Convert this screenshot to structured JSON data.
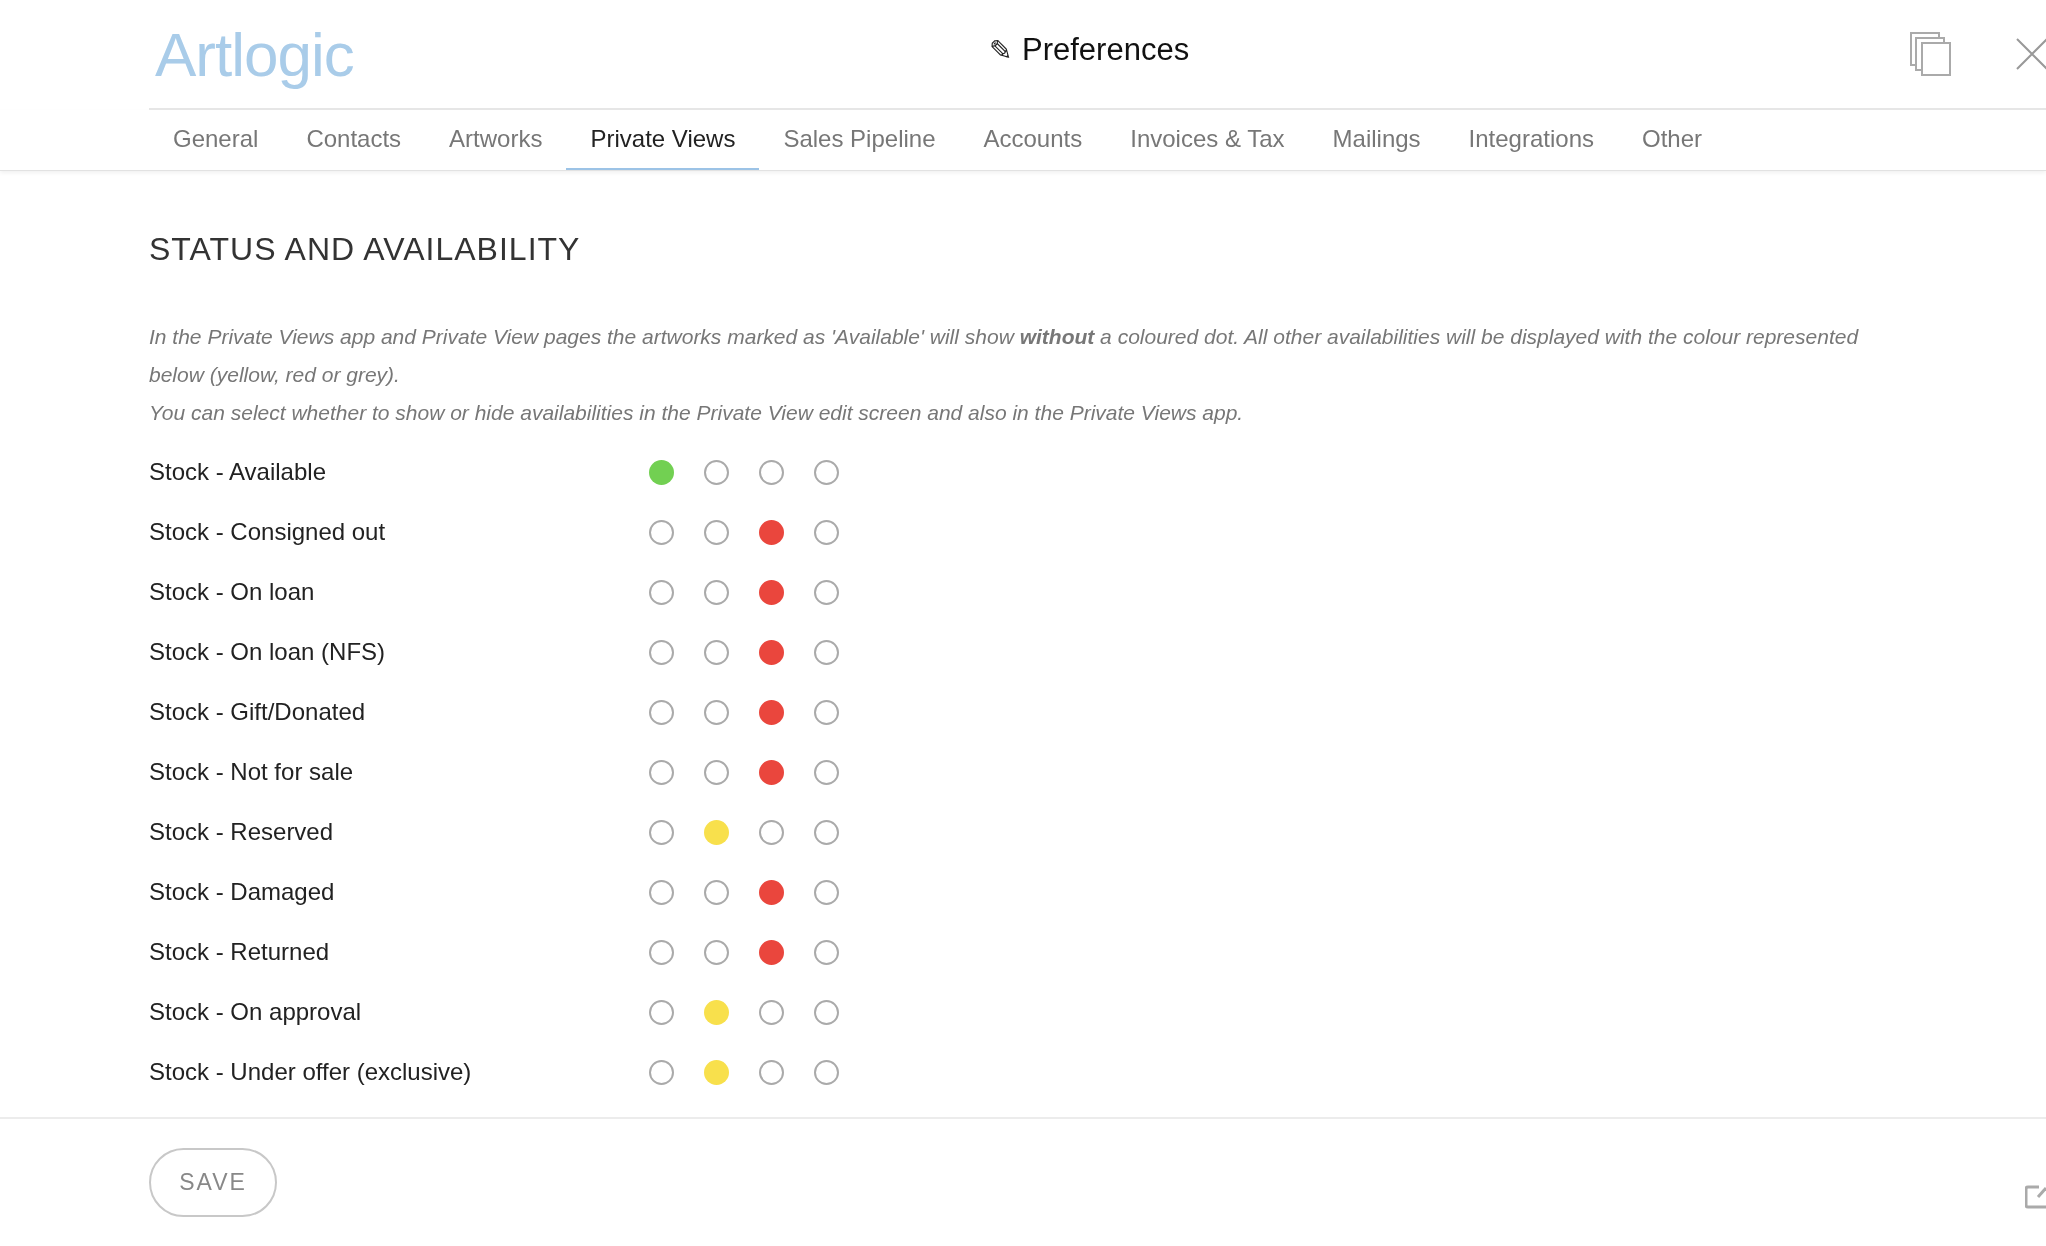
{
  "header": {
    "logo": "Artlogic",
    "title": "Preferences",
    "title_icon": "✎"
  },
  "tabs": [
    {
      "label": "General",
      "selected": false
    },
    {
      "label": "Contacts",
      "selected": false
    },
    {
      "label": "Artworks",
      "selected": false
    },
    {
      "label": "Private Views",
      "selected": true
    },
    {
      "label": "Sales Pipeline",
      "selected": false
    },
    {
      "label": "Accounts",
      "selected": false
    },
    {
      "label": "Invoices & Tax",
      "selected": false
    },
    {
      "label": "Mailings",
      "selected": false
    },
    {
      "label": "Integrations",
      "selected": false
    },
    {
      "label": "Other",
      "selected": false
    }
  ],
  "section": {
    "heading": "STATUS AND AVAILABILITY",
    "paragraphs": [
      "In the Private Views app and Private View pages the artworks marked as 'Available' will show **without** a coloured dot. All other availabilities will be displayed with the colour represented below (yellow, red or grey).",
      "You can select whether to show or hide availabilities in the Private View edit screen and also in the Private Views app."
    ]
  },
  "rows": [
    {
      "label": "Stock - Available",
      "color": "#72d052",
      "options": [
        {
          "selected": true
        },
        {
          "selected": false
        },
        {
          "selected": false
        },
        {
          "selected": false
        }
      ]
    },
    {
      "label": "Stock - Consigned out",
      "color": "#ea463d",
      "options": [
        {
          "selected": false
        },
        {
          "selected": false
        },
        {
          "selected": true
        },
        {
          "selected": false
        }
      ]
    },
    {
      "label": "Stock - On loan",
      "color": "#ea463d",
      "options": [
        {
          "selected": false
        },
        {
          "selected": false
        },
        {
          "selected": true
        },
        {
          "selected": false
        }
      ]
    },
    {
      "label": "Stock - On loan (NFS)",
      "color": "#ea463d",
      "options": [
        {
          "selected": false
        },
        {
          "selected": false
        },
        {
          "selected": true
        },
        {
          "selected": false
        }
      ]
    },
    {
      "label": "Stock - Gift/Donated",
      "color": "#ea463d",
      "options": [
        {
          "selected": false
        },
        {
          "selected": false
        },
        {
          "selected": true
        },
        {
          "selected": false
        }
      ]
    },
    {
      "label": "Stock - Not for sale",
      "color": "#ea463d",
      "options": [
        {
          "selected": false
        },
        {
          "selected": false
        },
        {
          "selected": true
        },
        {
          "selected": false
        }
      ]
    },
    {
      "label": "Stock - Reserved",
      "color": "#f8e04c",
      "options": [
        {
          "selected": false
        },
        {
          "selected": true
        },
        {
          "selected": false
        },
        {
          "selected": false
        }
      ]
    },
    {
      "label": "Stock - Damaged",
      "color": "#ea463d",
      "options": [
        {
          "selected": false
        },
        {
          "selected": false
        },
        {
          "selected": true
        },
        {
          "selected": false
        }
      ]
    },
    {
      "label": "Stock - Returned",
      "color": "#ea463d",
      "options": [
        {
          "selected": false
        },
        {
          "selected": false
        },
        {
          "selected": true
        },
        {
          "selected": false
        }
      ]
    },
    {
      "label": "Stock - On approval",
      "color": "#f8e04c",
      "options": [
        {
          "selected": false
        },
        {
          "selected": true
        },
        {
          "selected": false
        },
        {
          "selected": false
        }
      ]
    },
    {
      "label": "Stock - Under offer (exclusive)",
      "color": "#f8e04c",
      "options": [
        {
          "selected": false
        },
        {
          "selected": true
        },
        {
          "selected": false
        },
        {
          "selected": false
        }
      ]
    }
  ],
  "footer": {
    "save": "SAVE"
  }
}
